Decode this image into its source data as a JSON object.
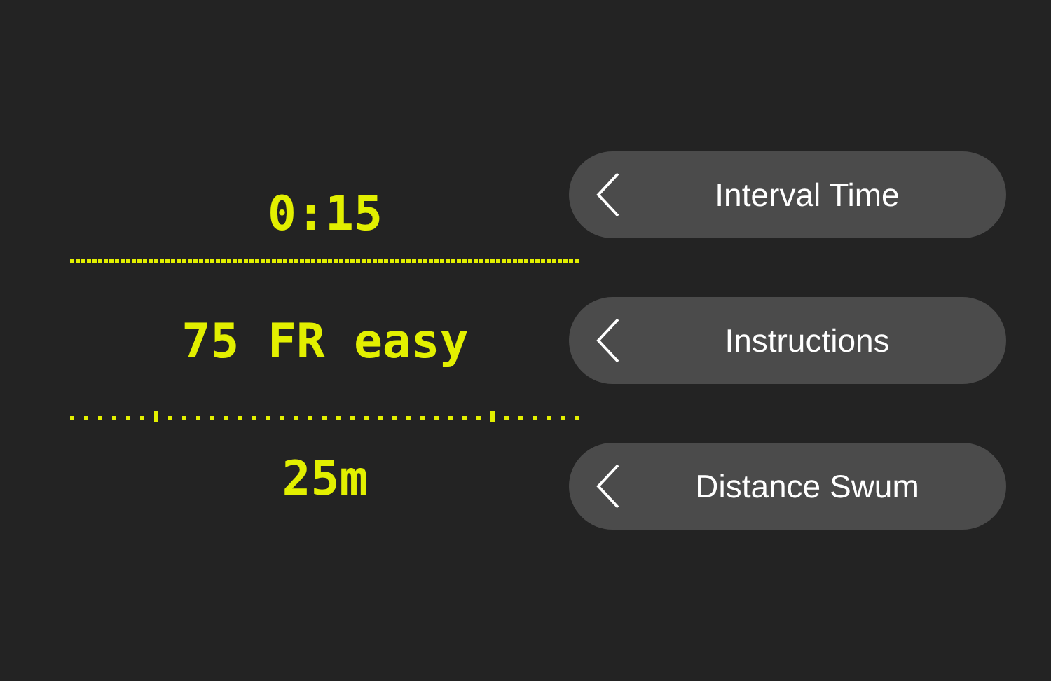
{
  "display": {
    "interval_time": "0:15",
    "instructions": "75 FR easy",
    "distance_swum": "25m"
  },
  "buttons": [
    {
      "label": "Interval Time"
    },
    {
      "label": "Instructions"
    },
    {
      "label": "Distance Swum"
    }
  ]
}
